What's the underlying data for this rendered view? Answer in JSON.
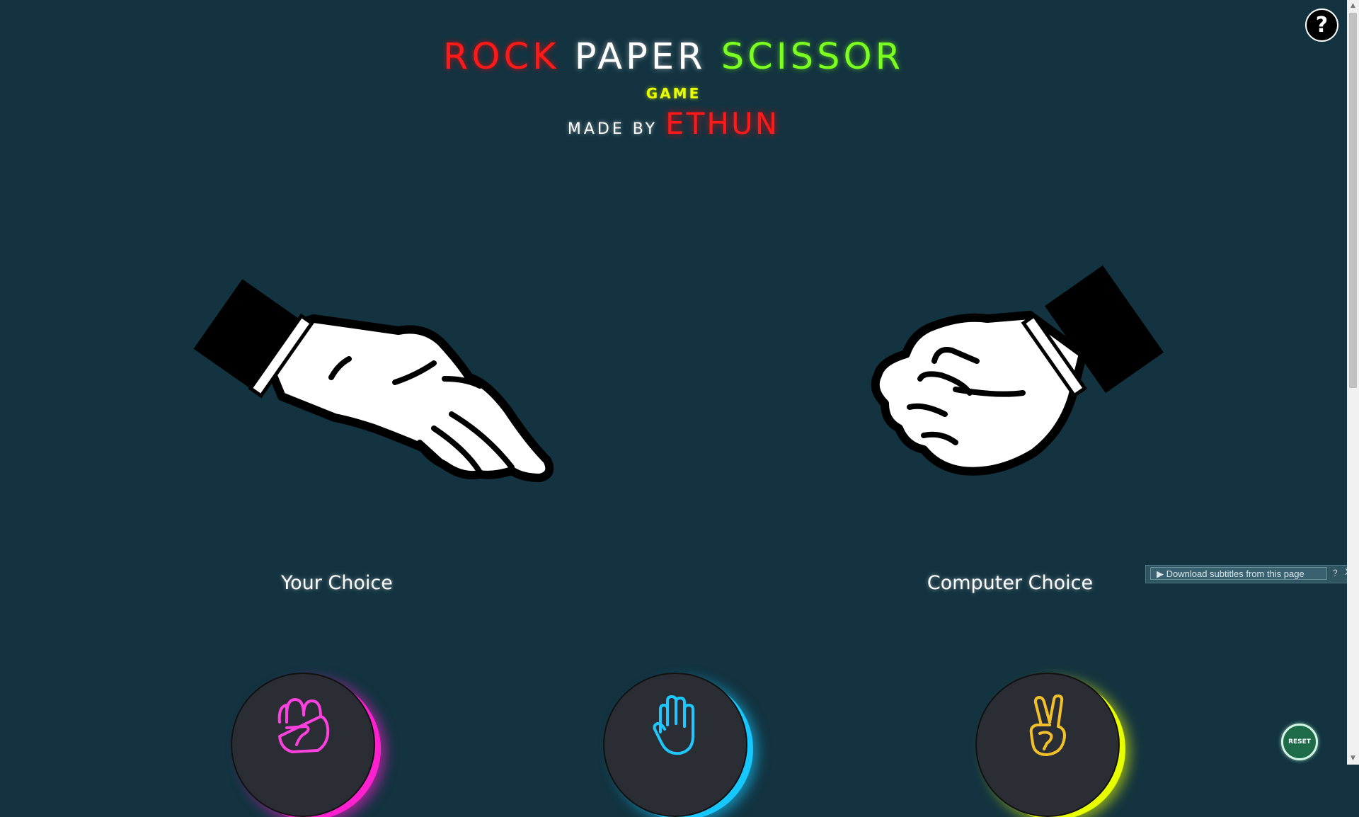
{
  "header": {
    "title_rock": "ROCK",
    "title_paper": "PAPER",
    "title_scissor": "SCISSOR",
    "subtitle": "GAME",
    "made_by": "MADE BY",
    "author": "ETHUN"
  },
  "help_button": {
    "label": "?"
  },
  "arena": {
    "your_choice_label": "Your Choice",
    "computer_choice_label": "Computer Choice",
    "your_hand": "paper-hand",
    "computer_hand": "rock-fist"
  },
  "choices": [
    {
      "name": "rock",
      "icon": "rock-fist-icon",
      "color": "#ff20d0"
    },
    {
      "name": "paper",
      "icon": "paper-hand-icon",
      "color": "#16c8ff"
    },
    {
      "name": "scissor",
      "icon": "scissor-hand-icon",
      "color": "#e8ff00"
    }
  ],
  "reset_button": {
    "label": "RESET"
  },
  "subtitle_extension": {
    "download_label": "Download subtitles from this page",
    "help": "?",
    "close": "X"
  },
  "colors": {
    "background": "#133340",
    "rock": "#ff1a1a",
    "paper": "#ffffff",
    "scissor": "#7bff1f",
    "game": "#e9ff00"
  }
}
